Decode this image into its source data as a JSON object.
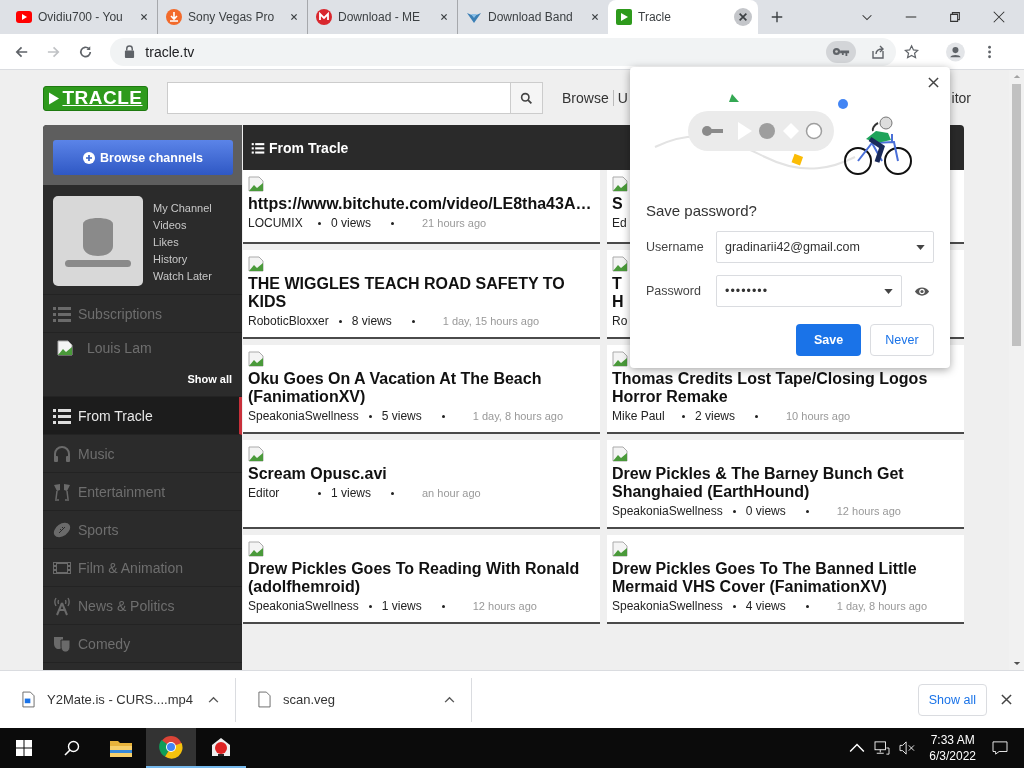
{
  "browser": {
    "tabs": [
      {
        "title": "Ovidiu700 - You",
        "selected": false
      },
      {
        "title": "Sony Vegas Pro",
        "selected": false
      },
      {
        "title": "Download - ME",
        "selected": false
      },
      {
        "title": "Download Band",
        "selected": false
      },
      {
        "title": "Tracle",
        "selected": true
      }
    ],
    "toolbar": {
      "url": "tracle.tv",
      "forward_disabled": true
    }
  },
  "site": {
    "logo": "TRACLE",
    "nav": [
      "Browse",
      "U",
      "itor"
    ]
  },
  "sidebar": {
    "browse_button": "Browse channels",
    "profile_links": [
      "My Channel",
      "Videos",
      "Likes",
      "History",
      "Watch Later"
    ],
    "subscriptions_label": "Subscriptions",
    "subscriptions": [
      "Louis Lam"
    ],
    "show_all": "Show all",
    "categories": [
      {
        "label": "From Tracle",
        "selected": true
      },
      {
        "label": "Music",
        "selected": false
      },
      {
        "label": "Entertainment",
        "selected": false
      },
      {
        "label": "Sports",
        "selected": false
      },
      {
        "label": "Film & Animation",
        "selected": false
      },
      {
        "label": "News & Politics",
        "selected": false
      },
      {
        "label": "Comedy",
        "selected": false
      }
    ]
  },
  "feed": {
    "title": "From Tracle",
    "videos": [
      {
        "title": "https://www.bitchute.com/video/LE8tha43A…",
        "channel": "LOCUMIX",
        "views": "0 views",
        "time": "21 hours ago"
      },
      {
        "title": "S",
        "channel": "Ed"
      },
      {
        "title": "THE WIGGLES TEACH ROAD SAFETY TO KIDS",
        "channel": "RoboticBloxxer",
        "views": "8 views",
        "time": "1 day, 15 hours ago"
      },
      {
        "title": "T\nH",
        "channel": "Ro"
      },
      {
        "title": "Oku Goes On A Vacation At The Beach (FanimationXV)",
        "channel": "SpeakoniaSwellness",
        "views": "5 views",
        "time": "1 day, 8 hours ago"
      },
      {
        "title": "Thomas Credits Lost Tape/Closing Logos Horror Remake",
        "channel": "Mike Paul",
        "views": "2 views",
        "time": "10 hours ago"
      },
      {
        "title": "Scream Opusc.avi",
        "channel": "Editor",
        "views": "1 views",
        "time": "an hour ago"
      },
      {
        "title": "Drew Pickles & The Barney Bunch Get Shanghaied (EarthHound)",
        "channel": "SpeakoniaSwellness",
        "views": "0 views",
        "time": "12 hours ago"
      },
      {
        "title": "Drew Pickles Goes To Reading With Ronald (adolfhemroid)",
        "channel": "SpeakoniaSwellness",
        "views": "1 views",
        "time": "12 hours ago"
      },
      {
        "title": "Drew Pickles Goes To The Banned Little Mermaid VHS Cover (FanimationXV)",
        "channel": "SpeakoniaSwellness",
        "views": "4 views",
        "time": "1 day, 8 hours ago"
      }
    ]
  },
  "password_popup": {
    "title": "Save password?",
    "username_label": "Username",
    "username": "gradinarii42@gmail.com",
    "password_label": "Password",
    "password": "••••••••",
    "save": "Save",
    "never": "Never"
  },
  "downloads": {
    "items": [
      "Y2Mate.is - CURS....mp4",
      "scan.veg"
    ],
    "show_all": "Show all"
  },
  "taskbar": {
    "apps": [
      {
        "open": false,
        "active": false
      },
      {
        "open": true,
        "active": true
      },
      {
        "open": true,
        "active": false
      }
    ],
    "time": "7:33 AM",
    "date": "6/3/2022"
  }
}
